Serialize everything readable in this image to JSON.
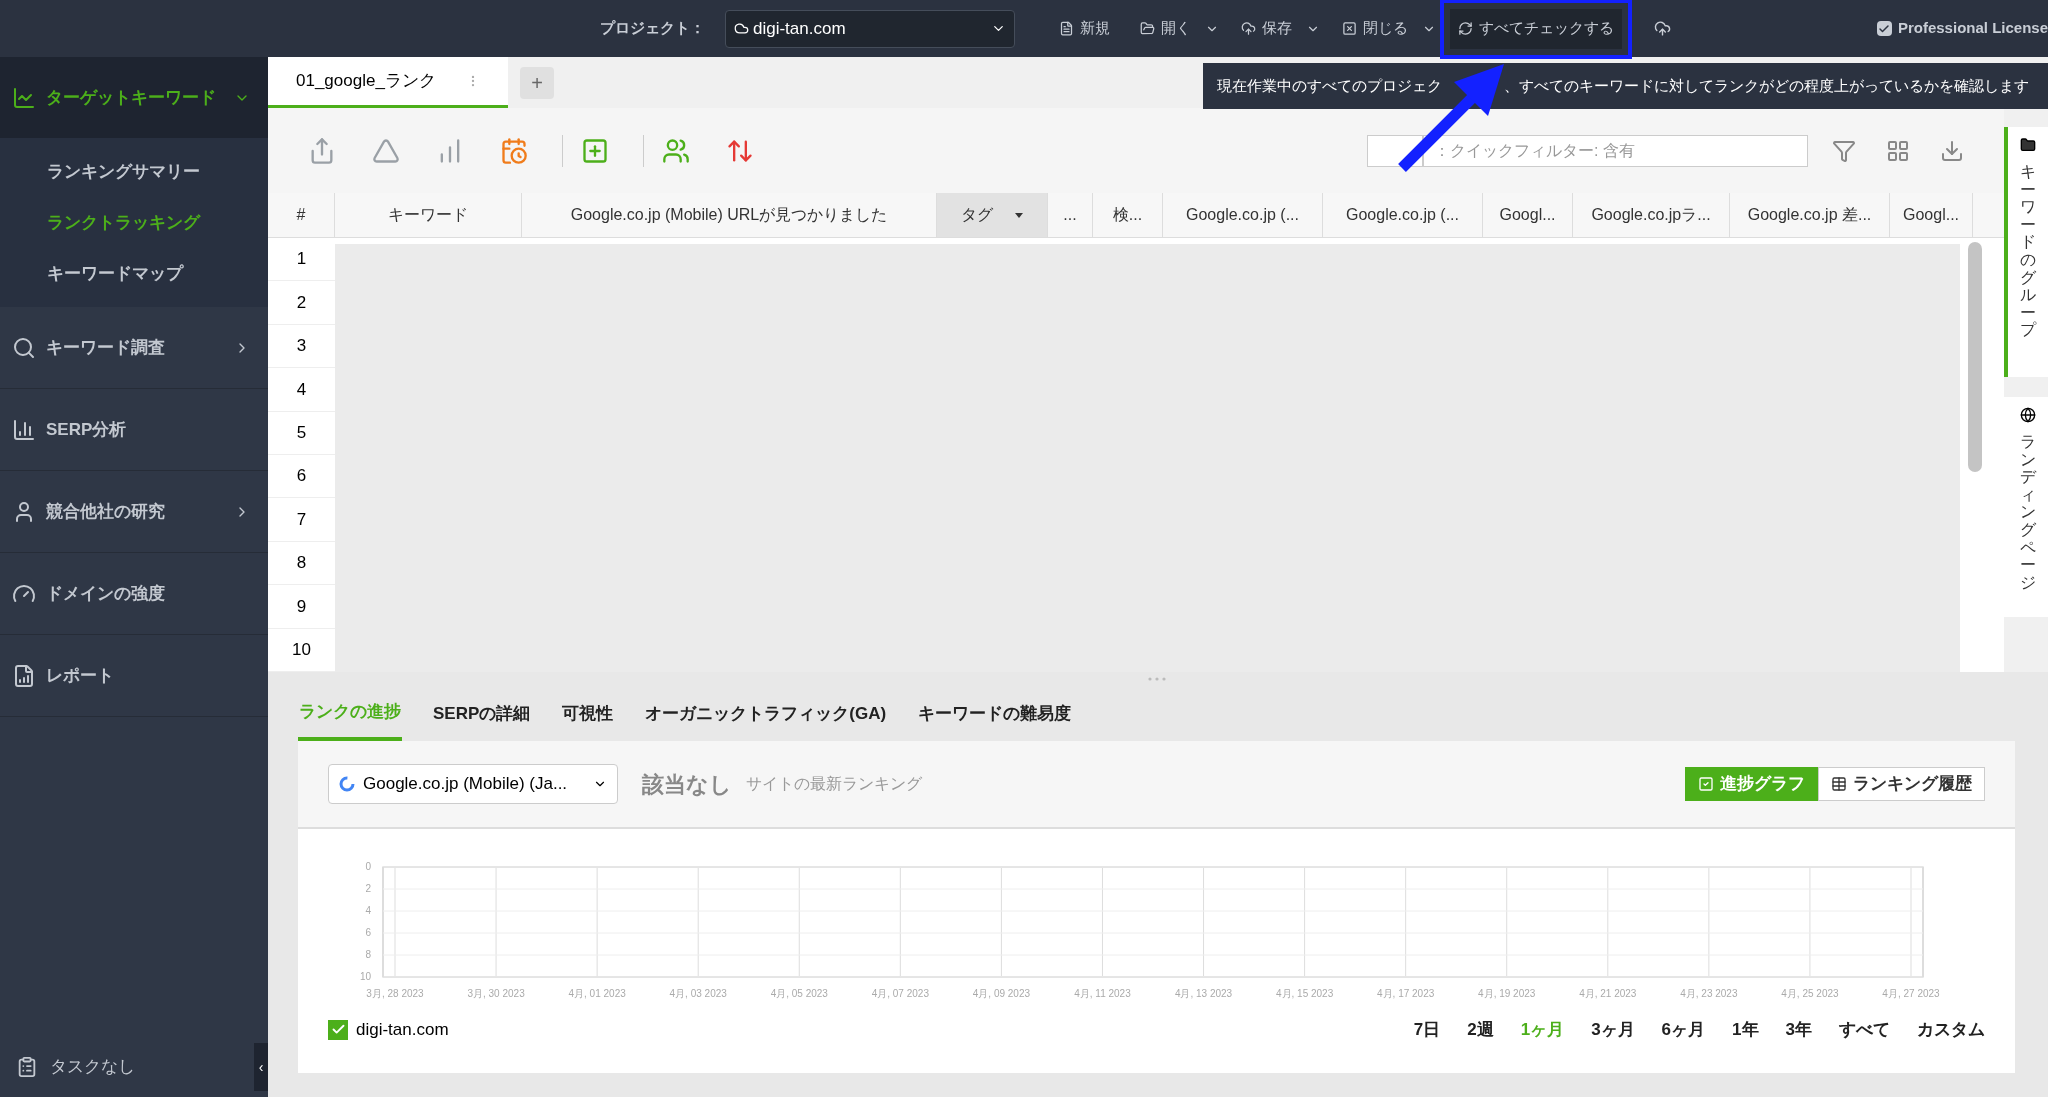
{
  "top_bar": {
    "project_label": "プロジェクト：",
    "project": "digi-tan.com",
    "menu": [
      {
        "label": "新規",
        "dropdown": false,
        "highlighted": false
      },
      {
        "label": "開く",
        "dropdown": true,
        "highlighted": false
      },
      {
        "label": "保存",
        "dropdown": true,
        "highlighted": false
      },
      {
        "label": "閉じる",
        "dropdown": true,
        "highlighted": false
      },
      {
        "label": "すべてチェックする",
        "dropdown": false,
        "highlighted": true
      }
    ],
    "license": {
      "label": "Professional License",
      "checked": true
    },
    "tooltip": [
      "現在作業中のすべてのプロジェク",
      "、すべてのキーワードに対してランクがどの程度上がっているかを確認します"
    ]
  },
  "sidebar": {
    "items": [
      {
        "label": "ターゲットキーワード",
        "selected": true,
        "expanded": true,
        "children": [
          {
            "label": "ランキングサマリー",
            "selected": false
          },
          {
            "label": "ランクトラッキング",
            "selected": true
          },
          {
            "label": "キーワードマップ",
            "selected": false
          }
        ]
      },
      {
        "label": "キーワード調査",
        "selected": false,
        "expanded": false
      },
      {
        "label": "SERP分析",
        "selected": false
      },
      {
        "label": "競合他社の研究",
        "selected": false,
        "expanded": false
      },
      {
        "label": "ドメインの強度",
        "selected": false
      },
      {
        "label": "レポート",
        "selected": false
      }
    ],
    "footer": "タスクなし",
    "collapse": "‹"
  },
  "doc_tabs": [
    {
      "label": "01_google_ランク",
      "selected": true
    }
  ],
  "doc_tab_add": "+",
  "quick_filter": {
    "placeholder": "：クイックフィルター: 含有"
  },
  "table": {
    "columns": [
      {
        "label": "#",
        "sorted": false
      },
      {
        "label": "キーワード",
        "sorted": false
      },
      {
        "label": "Google.co.jp (Mobile) URLが見つかりました",
        "sorted": false
      },
      {
        "label": "タグ",
        "sorted": true
      },
      {
        "label": "...",
        "sorted": false
      },
      {
        "label": "検...",
        "sorted": false
      },
      {
        "label": "Google.co.jp (...",
        "sorted": false
      },
      {
        "label": "Google.co.jp (...",
        "sorted": false
      },
      {
        "label": "Googl...",
        "sorted": false
      },
      {
        "label": "Google.co.jpラ...",
        "sorted": false
      },
      {
        "label": "Google.co.jp 差...",
        "sorted": false
      },
      {
        "label": "Googl...",
        "sorted": false
      }
    ],
    "rows": [
      "1",
      "2",
      "3",
      "4",
      "5",
      "6",
      "7",
      "8",
      "9",
      "10"
    ]
  },
  "side_panels": [
    {
      "label": "キーワードのグループ",
      "selected": true
    },
    {
      "label": "ランディングページ",
      "selected": false
    }
  ],
  "bottom_tabs": [
    {
      "label": "ランクの進捗",
      "selected": true
    },
    {
      "label": "SERPの詳細",
      "selected": false
    },
    {
      "label": "可視性",
      "selected": false
    },
    {
      "label": "オーガニックトラフィック(GA)",
      "selected": false
    },
    {
      "label": "キーワードの難易度",
      "selected": false
    }
  ],
  "progress": {
    "engine": "Google.co.jp (Mobile) (Ja...",
    "status": "該当なし",
    "status_note": "サイトの最新ランキング",
    "views": [
      {
        "label": "進捗グラフ",
        "selected": true
      },
      {
        "label": "ランキング履歴",
        "selected": false
      }
    ],
    "chart_data": {
      "type": "line",
      "categories": [
        "3月, 28 2023",
        "3月, 30 2023",
        "4月, 01 2023",
        "4月, 03 2023",
        "4月, 05 2023",
        "4月, 07 2023",
        "4月, 09 2023",
        "4月, 11 2023",
        "4月, 13 2023",
        "4月, 15 2023",
        "4月, 17 2023",
        "4月, 19 2023",
        "4月, 21 2023",
        "4月, 23 2023",
        "4月, 25 2023",
        "4月, 27 2023"
      ],
      "yticks": [
        0,
        2,
        4,
        6,
        8,
        10
      ],
      "ylim": [
        10,
        0
      ],
      "grid": true
    },
    "legend": [
      {
        "label": "digi-tan.com",
        "checked": true
      }
    ],
    "ranges": [
      {
        "label": "7日",
        "selected": false
      },
      {
        "label": "2週",
        "selected": false
      },
      {
        "label": "1ヶ月",
        "selected": true
      },
      {
        "label": "3ヶ月",
        "selected": false
      },
      {
        "label": "6ヶ月",
        "selected": false
      },
      {
        "label": "1年",
        "selected": false
      },
      {
        "label": "3年",
        "selected": false
      },
      {
        "label": "すべて",
        "selected": false
      },
      {
        "label": "カスタム",
        "selected": false
      }
    ]
  }
}
